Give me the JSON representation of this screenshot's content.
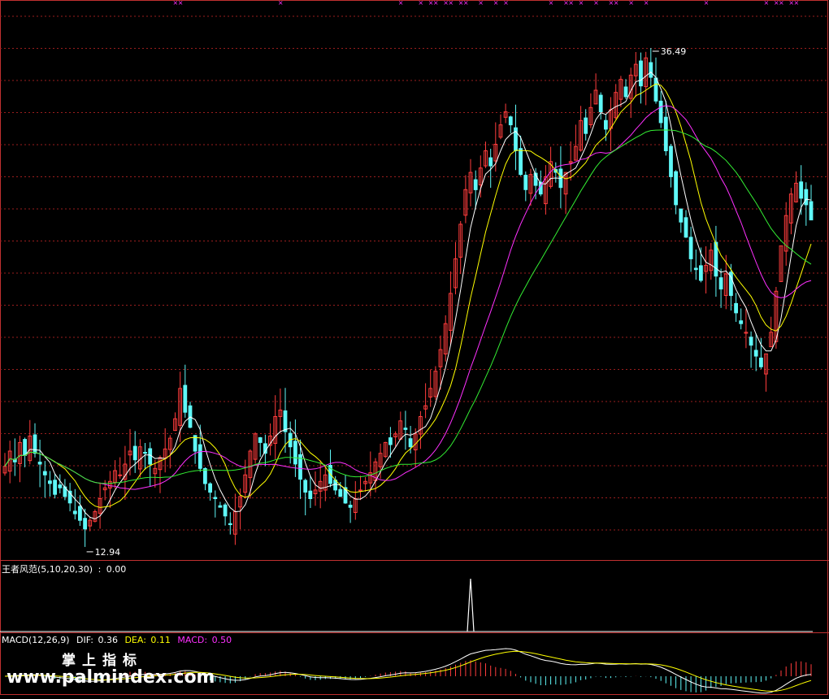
{
  "chart_data": [
    {
      "type": "candlestick",
      "panel": "price",
      "series_colors": {
        "up": "#ff3c3c",
        "down": "#5ff8f8",
        "ma5": "#ffffff",
        "ma10": "#ffff00",
        "ma20": "#ff30ff",
        "ma30": "#33ee33"
      },
      "grid": "dotted-horizontal",
      "high_label": "36.49",
      "low_label": "12.94",
      "ylim": [
        12.0,
        37.2
      ],
      "closes": [
        16.0,
        16.7,
        16.2,
        17.1,
        16.5,
        17.4,
        16.6,
        16.1,
        15.6,
        15.2,
        14.7,
        15.0,
        14.6,
        14.3,
        13.8,
        13.5,
        13.1,
        13.5,
        13.9,
        14.5,
        15.0,
        15.3,
        15.8,
        15.6,
        16.1,
        16.7,
        16.3,
        16.9,
        16.6,
        16.1,
        15.9,
        16.4,
        16.8,
        17.3,
        18.2,
        19.6,
        18.5,
        17.8,
        16.7,
        15.9,
        15.2,
        14.8,
        14.5,
        14.1,
        13.7,
        13.3,
        13.9,
        14.6,
        15.6,
        16.7,
        17.5,
        17.1,
        16.6,
        17.4,
        18.3,
        18.6,
        17.6,
        16.9,
        16.1,
        15.4,
        14.8,
        14.5,
        14.9,
        15.3,
        15.6,
        15.2,
        14.9,
        14.6,
        14.3,
        14.1,
        14.5,
        14.9,
        15.3,
        15.7,
        16.2,
        16.6,
        17.1,
        17.0,
        17.5,
        18.1,
        17.7,
        16.9,
        17.5,
        18.3,
        18.8,
        19.6,
        20.4,
        21.4,
        22.6,
        24.0,
        25.6,
        27.2,
        28.8,
        29.6,
        28.8,
        29.8,
        30.6,
        29.9,
        30.9,
        31.8,
        32.4,
        31.8,
        30.6,
        29.5,
        28.8,
        29.5,
        29.0,
        28.6,
        29.4,
        30.1,
        29.6,
        28.9,
        29.6,
        30.1,
        30.8,
        32.0,
        31.4,
        32.6,
        33.4,
        32.4,
        31.6,
        32.5,
        33.3,
        33.9,
        33.1,
        34.1,
        34.6,
        33.6,
        34.9,
        34.0,
        32.9,
        31.9,
        30.6,
        29.4,
        28.1,
        27.3,
        26.6,
        25.6,
        25.1,
        24.6,
        25.3,
        26.0,
        24.8,
        24.2,
        24.9,
        23.9,
        23.1,
        22.6,
        22.2,
        21.6,
        21.1,
        20.6,
        21.2,
        22.2,
        24.1,
        26.2,
        27.6,
        28.6,
        29.1,
        28.4,
        28.1,
        27.4
      ]
    },
    {
      "type": "line",
      "panel": "indicator",
      "title": "王者风范(5,10,20,30)",
      "value": "0.00",
      "spike_index": 93,
      "colors": {
        "line": "#ffffff",
        "baseline": "#ffffff"
      }
    },
    {
      "type": "bar-line",
      "panel": "macd",
      "title": "MACD(12,26,9)",
      "dif_label": "DIF:",
      "dif": "0.36",
      "dea_label": "DEA:",
      "dea": "0.11",
      "macd_label": "MACD:",
      "macd": "0.50",
      "colors": {
        "dif": "#ffffff",
        "dea": "#ffff00",
        "macd": "#ff30ff",
        "title": "#ffffff"
      }
    }
  ],
  "watermark": {
    "line1": "掌上指标",
    "line2": "www.palmindex.com"
  },
  "colors": {
    "background": "#000000",
    "frame": "#c03030",
    "grid": "#9a1e1e"
  }
}
